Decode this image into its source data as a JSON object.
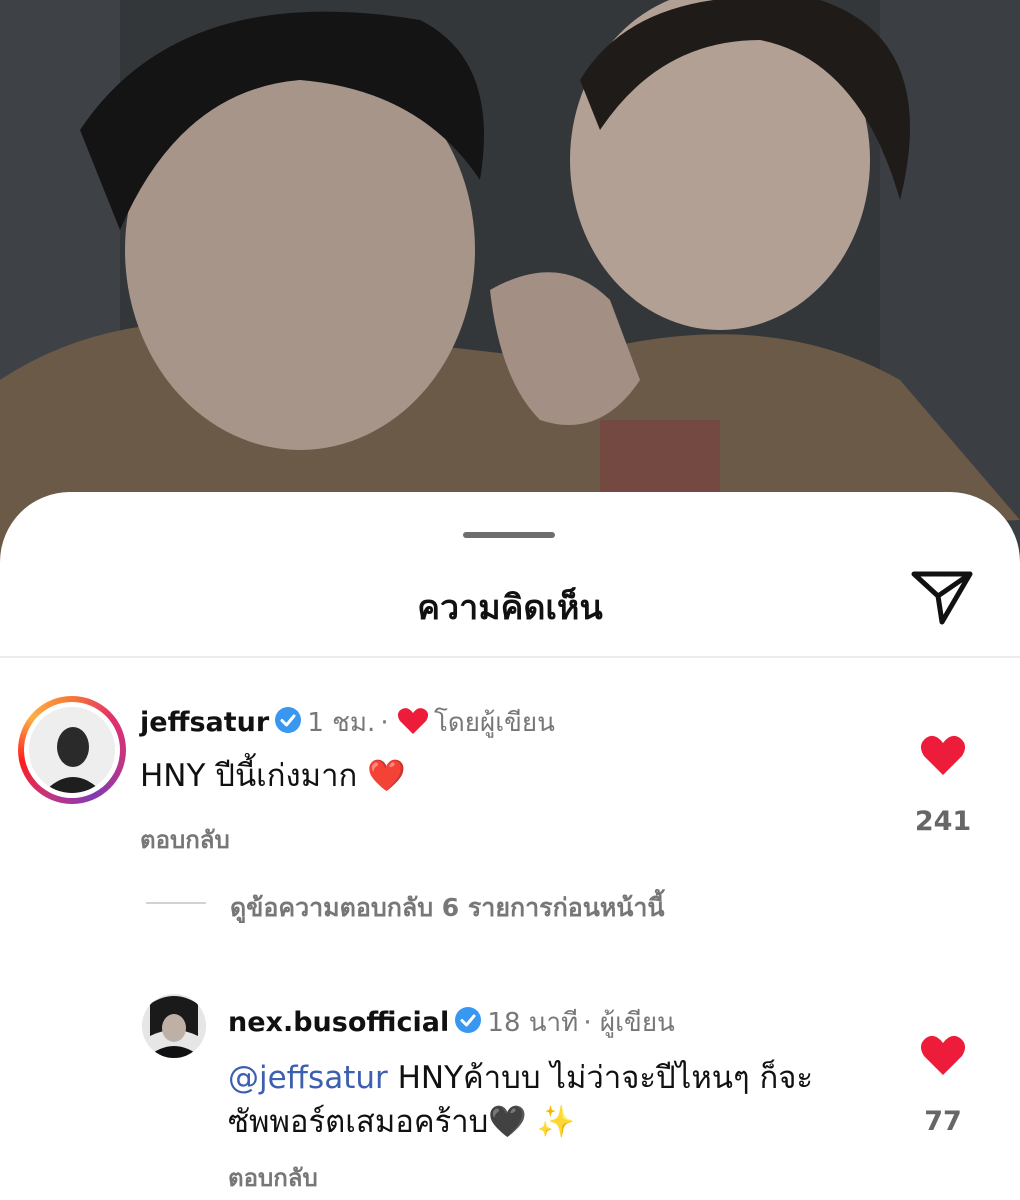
{
  "sheet": {
    "title": "ความคิดเห็น"
  },
  "comments": [
    {
      "username": "jeffsatur",
      "time": "1 ชม.",
      "author_liked": "โดยผู้เขียน",
      "text": "HNY ปีนี้เก่งมาก",
      "emoji": "❤️",
      "reply_label": "ตอบกลับ",
      "likes": "241"
    }
  ],
  "view_replies": "ดูข้อความตอบกลับ 6 รายการก่อนหน้านี้",
  "reply": {
    "username": "nex.busofficial",
    "time": "18 นาที",
    "author_label": "ผู้เขียน",
    "mention": "@jeffsatur",
    "text_line1": " HNYค้าบบ ไม่ว่าจะปีไหนๆ ก็จะ",
    "text_line2": "ซัพพอร์ตเสมอคร้าบ",
    "emoji": "🖤 ✨",
    "reply_label": "ตอบกลับ",
    "likes": "77"
  },
  "colors": {
    "heart": "#ed1c3a",
    "verified": "#3897f0",
    "mention": "#3d5fb0"
  }
}
